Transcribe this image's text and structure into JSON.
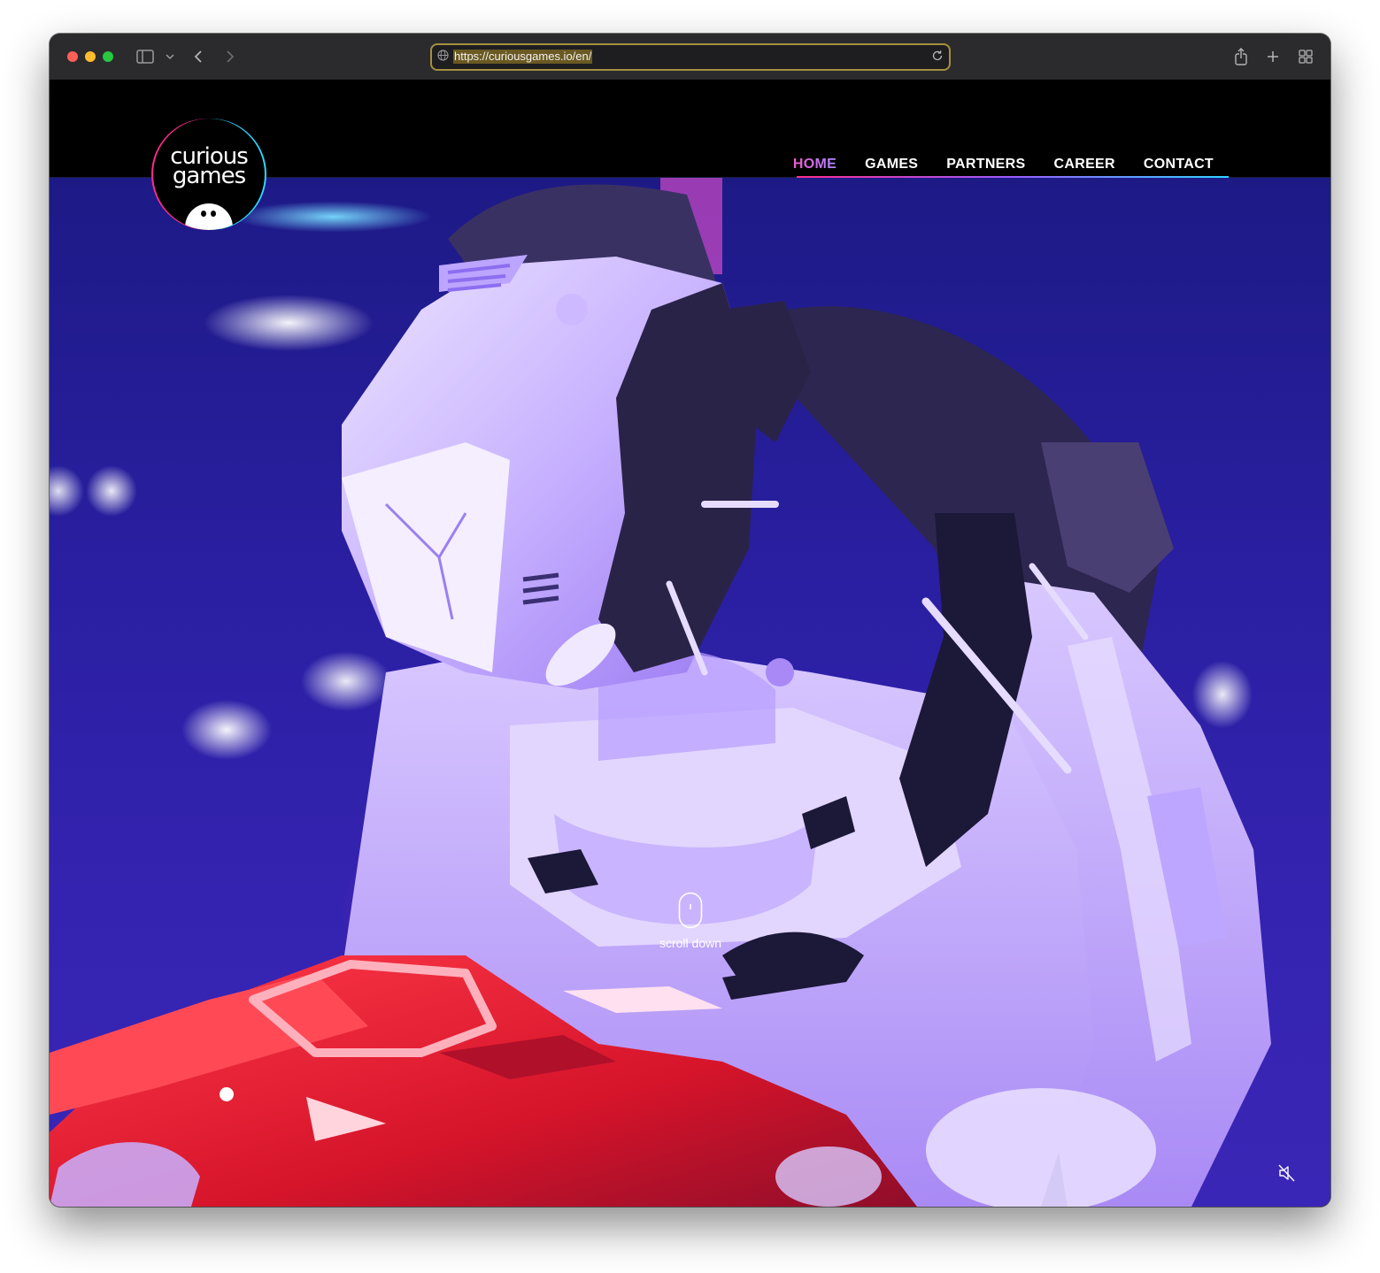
{
  "browser": {
    "url": "https://curiousgames.io/en/",
    "icons": [
      "sidebar-icon",
      "chevron-down-icon",
      "back-icon",
      "forward-icon",
      "globe-icon",
      "reload-icon",
      "share-icon",
      "new-tab-icon",
      "tab-overview-icon"
    ]
  },
  "site": {
    "logo": {
      "line1": "curious",
      "line2": "games"
    },
    "nav": [
      {
        "label": "HOME",
        "active": true
      },
      {
        "label": "GAMES"
      },
      {
        "label": "PARTNERS"
      },
      {
        "label": "CAREER"
      },
      {
        "label": "CONTACT"
      }
    ],
    "hero": {
      "scroll_label": "scroll down",
      "icons": [
        "mouse-scroll-icon",
        "mute-icon"
      ]
    },
    "colors": {
      "active_nav_start": "#ff4fb0",
      "active_nav_end": "#8fd0ff",
      "underline_pink": "#ff2d8c",
      "underline_cyan": "#2fd6ff",
      "header_bg": "#000000"
    }
  }
}
